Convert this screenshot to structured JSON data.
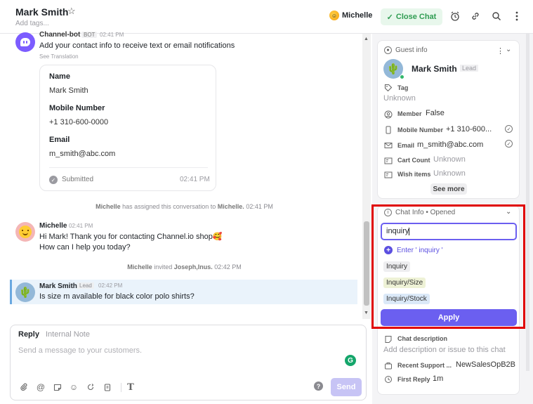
{
  "header": {
    "title": "Mark Smith",
    "add_tags": "Add tags...",
    "assignee": "Michelle",
    "close_chat": "Close Chat"
  },
  "chat": {
    "bot": {
      "name": "Channel-bot",
      "badge": "BOT",
      "time": "02:41 PM",
      "message": "Add your contact info to receive text or email notifications",
      "see_translation": "See Translation"
    },
    "form": {
      "fields": [
        {
          "label": "Name",
          "value": "Mark Smith"
        },
        {
          "label": "Mobile Number",
          "value": "+1 310-600-0000"
        },
        {
          "label": "Email",
          "value": "m_smith@abc.com"
        }
      ],
      "status": "Submitted",
      "time": "02:41 PM"
    },
    "system_assign": {
      "actor": "Michelle",
      "middle": "has assigned this conversation to",
      "target": "Michelle.",
      "time": "02:41 PM"
    },
    "agent_msg": {
      "name": "Michelle",
      "time": "02:41 PM",
      "line1": "Hi Mark! Thank you for contacting Channel.io shop🥰",
      "line2": "How can I help you today?"
    },
    "system_invite": {
      "actor": "Michelle",
      "middle": "invited",
      "target": "Joseph,Inus.",
      "time": "02:42 PM"
    },
    "guest_msg": {
      "name": "Mark Smith",
      "badge": "Lead",
      "time": "02:42 PM",
      "text": "Is size m available for black color polo shirts?"
    }
  },
  "composer": {
    "tab_reply": "Reply",
    "tab_note": "Internal Note",
    "placeholder": "Send a message to your customers.",
    "send": "Send"
  },
  "panel": {
    "guest_info": {
      "title": "Guest info",
      "name": "Mark Smith",
      "badge": "Lead",
      "tag_label": "Tag",
      "tag_value": "Unknown",
      "rows": [
        {
          "key": "Member",
          "value": "False"
        },
        {
          "key": "Mobile Number",
          "value": "+1 310-600..."
        },
        {
          "key": "Email",
          "value": "m_smith@abc.com"
        },
        {
          "key": "Cart Count",
          "value": "Unknown"
        },
        {
          "key": "Wish items",
          "value": "Unknown"
        }
      ],
      "see_more": "See more"
    },
    "chat_info": {
      "title": "Chat Info • Opened",
      "input_value": "inquiry",
      "enter_option": "Enter ' inquiry '",
      "tags": [
        {
          "label": "Inquiry",
          "color": "#eeeef0"
        },
        {
          "label": "Inquiry/Size",
          "color": "#eef2d6"
        },
        {
          "label": "Inquiry/Stock",
          "color": "#dbe9f8"
        }
      ],
      "apply": "Apply",
      "desc_label": "Chat description",
      "desc_placeholder": "Add description or issue to this chat",
      "recent_label": "Recent Support ...",
      "recent_value": "NewSalesOpB2B",
      "first_reply_label": "First Reply",
      "first_reply_value": "1m"
    }
  },
  "colors": {
    "accent": "#6b5ff0",
    "highlight_border": "#e00000",
    "close_chat_text": "#2f9c52"
  }
}
